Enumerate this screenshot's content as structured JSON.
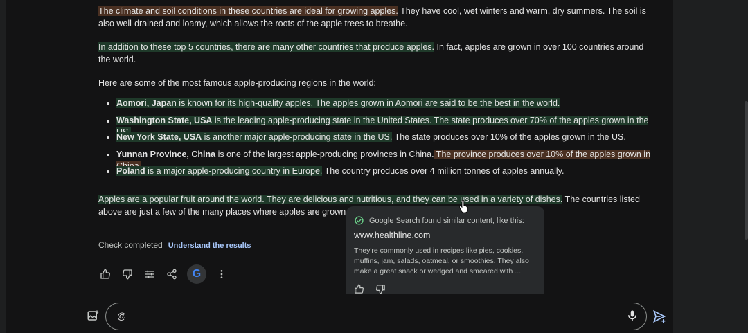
{
  "response": {
    "p1_hl": "The climate and soil conditions in these countries are ideal for growing apples.",
    "p1_rest": " They have cool, wet winters and warm, dry summers. The soil is also well-drained and loamy, which allows the roots of the apple trees to breathe.",
    "p2_hl": "In addition to these top 5 countries, there are many other countries that produce apples.",
    "p2_rest": " In fact, apples are grown in over 100 countries around the world.",
    "p3": "Here are some of the most famous apple-producing regions in the world:",
    "regions": [
      {
        "name": "Aomori, Japan",
        "a": " is known for its high-quality apples.",
        "b": " The apples grown in Aomori are said to be the best in the world."
      },
      {
        "name": "Washington State, USA",
        "a": " is the leading apple-producing state in the United States.",
        "b": " The state produces over 70% of the apples grown in the US."
      },
      {
        "name": "New York State, USA",
        "a": " is another major apple-producing state in the US.",
        "b": " The state produces over 10% of the apples grown in the US."
      },
      {
        "name": "Yunnan Province, China",
        "a": " is one of the largest apple-producing provinces in China.",
        "b": " The province produces over 10% of the apples grown in China."
      },
      {
        "name": "Poland",
        "a": " is a major apple-producing country in Europe.",
        "b": " The country produces over 4 million tonnes of apples annually."
      }
    ],
    "p4_hl1": "Apples are a popular fruit around the world.",
    "p4_hl2": " They are delicious and nutritious, and they can be used in a variety of dishes.",
    "p4_rest": " The countries listed above are just a few of the many places where apples are grown."
  },
  "check": {
    "status": "Check completed",
    "link": "Understand the results"
  },
  "popup": {
    "header": "Google Search found similar content, like this:",
    "site": "www.healthline.com",
    "snippet": "They're commonly used in recipes like pies, cookies, muffins, jam, salads, oatmeal, or smoothies. They also make a great snack or wedged and smeared with ..."
  },
  "actions": {
    "icons": [
      "thumbs-up-icon",
      "thumbs-down-icon",
      "tune-icon",
      "share-icon",
      "google-g-icon",
      "more-vert-icon"
    ],
    "google_letter": "G"
  },
  "input": {
    "value": "@"
  },
  "colors": {
    "background": "#131314",
    "green_highlight": "#1f3a2a",
    "orange_highlight": "#4a3022",
    "link": "#a8c7fa"
  }
}
